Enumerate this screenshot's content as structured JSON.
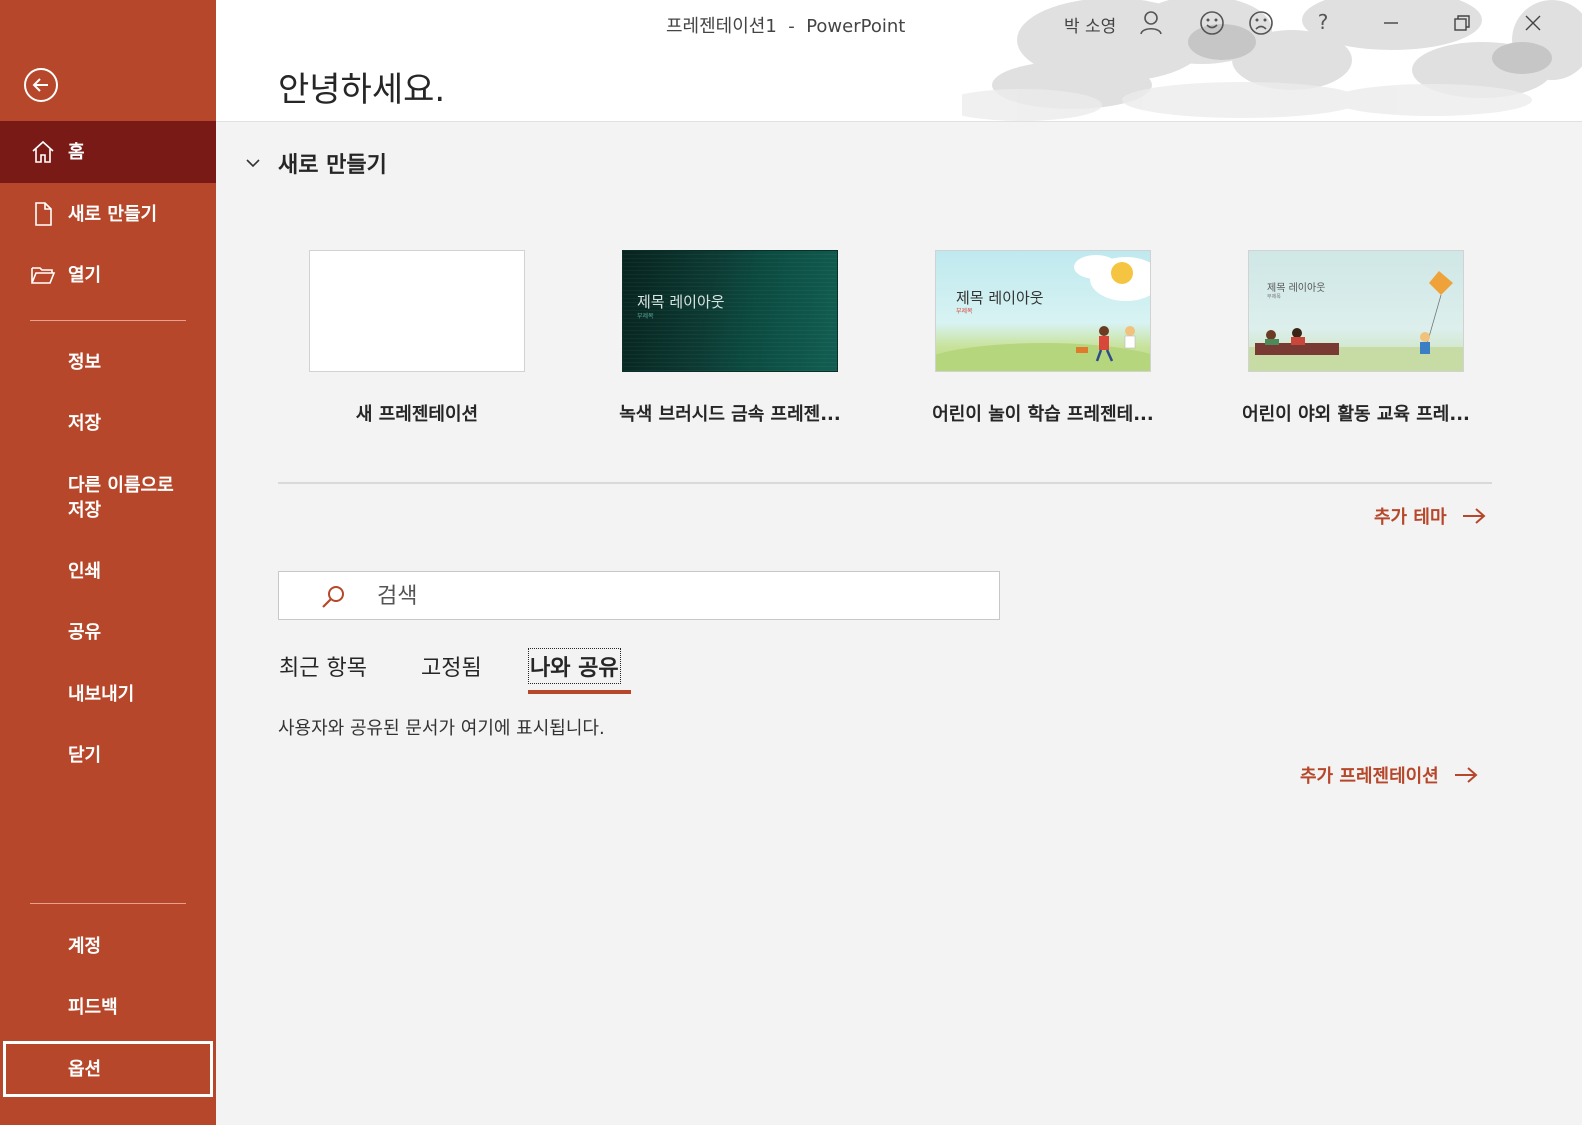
{
  "window": {
    "title": "프레젠테이션1  -  PowerPoint",
    "user_name": "박 소영",
    "help_label": "?"
  },
  "sidebar": {
    "nav_top": [
      {
        "key": "home",
        "label": "홈"
      },
      {
        "key": "new",
        "label": "새로 만들기"
      },
      {
        "key": "open",
        "label": "열기"
      }
    ],
    "nav_mid": [
      {
        "key": "info",
        "label": "정보"
      },
      {
        "key": "save",
        "label": "저장"
      },
      {
        "key": "save-as",
        "label": "다른 이름으로\n저장"
      },
      {
        "key": "print",
        "label": "인쇄"
      },
      {
        "key": "share",
        "label": "공유"
      },
      {
        "key": "export",
        "label": "내보내기"
      },
      {
        "key": "close",
        "label": "닫기"
      }
    ],
    "nav_bottom": [
      {
        "key": "account",
        "label": "계정"
      },
      {
        "key": "feedback",
        "label": "피드백"
      },
      {
        "key": "options",
        "label": "옵션"
      }
    ],
    "active": "home",
    "focused": "options"
  },
  "greeting": "안녕하세요.",
  "new_section": {
    "heading": "새로 만들기",
    "templates": [
      {
        "key": "blank",
        "name": "새 프레젠테이션"
      },
      {
        "key": "green-metal",
        "name": "녹색 브러시드 금속 프레젠...",
        "thumb_title": "제목 레이아웃",
        "thumb_sub": "부제목"
      },
      {
        "key": "kids-play",
        "name": "어린이 놀이 학습 프레젠테...",
        "thumb_title": "제목 레이아웃",
        "thumb_sub": "부제목"
      },
      {
        "key": "kids-outdoor",
        "name": "어린이 야외 활동 교육 프레...",
        "thumb_title": "제목 레이아웃",
        "thumb_sub": "부제목"
      }
    ],
    "more_themes": "추가 테마"
  },
  "search": {
    "placeholder": "검색"
  },
  "tabs": [
    {
      "key": "recent",
      "label": "최근 항목"
    },
    {
      "key": "pinned",
      "label": "고정됨"
    },
    {
      "key": "shared",
      "label": "나와 공유"
    }
  ],
  "active_tab": "shared",
  "empty_message": "사용자와 공유된 문서가 여기에 표시됩니다.",
  "more_presentations": "추가 프레젠테이션",
  "colors": {
    "sidebar": "#b7472a",
    "sidebar_active": "#7a1a17",
    "accent": "#b7472a",
    "content_bg": "#f3f3f3"
  }
}
